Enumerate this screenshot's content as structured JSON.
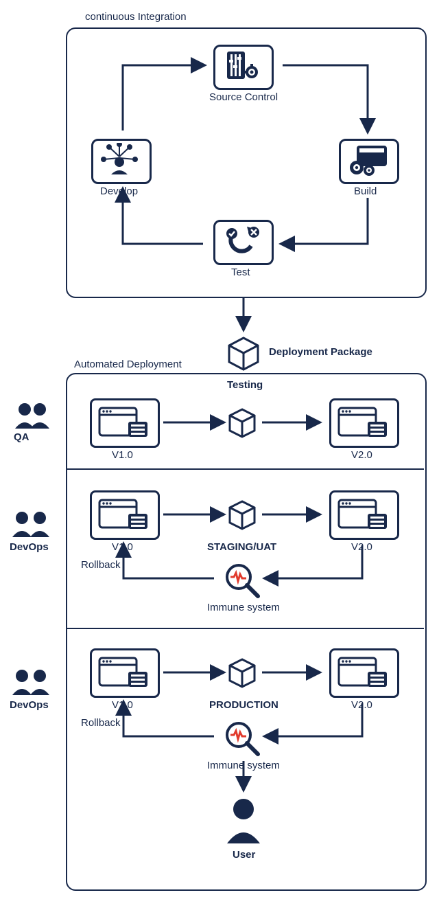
{
  "ci": {
    "title": "continuous Integration",
    "develop": "Develop",
    "source_control": "Source Control",
    "build": "Build",
    "test": "Test"
  },
  "pkg": {
    "label": "Deployment Package"
  },
  "ad": {
    "title": "Automated Deployment",
    "testing": {
      "title": "Testing",
      "v1": "V1.0",
      "v2": "V2.0",
      "role": "QA"
    },
    "staging": {
      "title": "STAGING/UAT",
      "v1": "V1.0",
      "v2": "V2.0",
      "rollback": "Rollback",
      "immune": "Immune system",
      "role": "DevOps"
    },
    "production": {
      "title": "PRODUCTION",
      "v1": "V1.0",
      "v2": "V2.0",
      "rollback": "Rollback",
      "immune": "Immune system",
      "user": "User",
      "role": "DevOps"
    }
  }
}
